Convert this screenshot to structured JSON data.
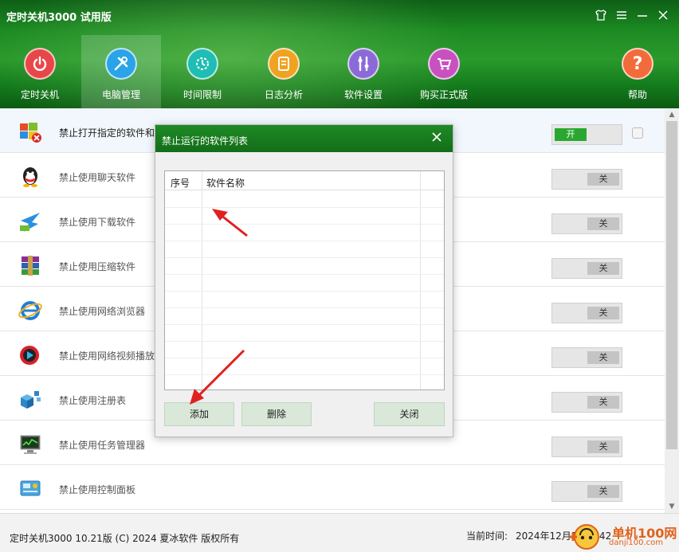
{
  "app": {
    "title": "定时关机3000 试用版"
  },
  "window_controls": [
    "shirt-icon",
    "menu-icon",
    "minimize-icon",
    "close-icon"
  ],
  "nav": {
    "items": [
      {
        "label": "定时关机",
        "icon": "power-icon",
        "color": "#e8474a"
      },
      {
        "label": "电脑管理",
        "icon": "tools-icon",
        "color": "#29a4e8",
        "active": true
      },
      {
        "label": "时间限制",
        "icon": "timer-icon",
        "color": "#1fbdb3"
      },
      {
        "label": "日志分析",
        "icon": "log-icon",
        "color": "#f0a221"
      },
      {
        "label": "软件设置",
        "icon": "wrench-icon",
        "color": "#8b6ad8"
      },
      {
        "label": "购买正式版",
        "icon": "cart-icon",
        "color": "#c850c0"
      },
      {
        "label": "帮助",
        "icon": "help-icon",
        "color": "#f26b3a"
      }
    ]
  },
  "features": [
    {
      "label": "禁止打开指定的软件和",
      "icon": "windows-block-icon",
      "state": "开",
      "on": true
    },
    {
      "label": "禁止使用聊天软件",
      "icon": "qq-icon",
      "state": "关",
      "on": false
    },
    {
      "label": "禁止使用下载软件",
      "icon": "thunder-download-icon",
      "state": "关",
      "on": false
    },
    {
      "label": "禁止使用压缩软件",
      "icon": "winrar-icon",
      "state": "关",
      "on": false
    },
    {
      "label": "禁止使用网络浏览器",
      "icon": "ie-browser-icon",
      "state": "关",
      "on": false
    },
    {
      "label": "禁止使用网络视频播放",
      "icon": "video-player-icon",
      "state": "关",
      "on": false
    },
    {
      "label": "禁止使用注册表",
      "icon": "registry-icon",
      "state": "关",
      "on": false
    },
    {
      "label": "禁止使用任务管理器",
      "icon": "task-manager-icon",
      "state": "关",
      "on": false
    },
    {
      "label": "禁止使用控制面板",
      "icon": "control-panel-icon",
      "state": "关",
      "on": false
    }
  ],
  "status": {
    "copyright": "定时关机3000 10.21版 (C) 2024 夏冰软件 版权所有",
    "time_label": "当前时间:",
    "time_value": "2024年12月1日 4:42"
  },
  "watermark": {
    "text": "单机100网",
    "sub": "danji100.com"
  },
  "dialog": {
    "title": "禁止运行的软件列表",
    "columns": [
      "序号",
      "软件名称"
    ],
    "rows": [],
    "buttons": {
      "add": "添加",
      "delete": "删除",
      "close": "关闭"
    }
  }
}
